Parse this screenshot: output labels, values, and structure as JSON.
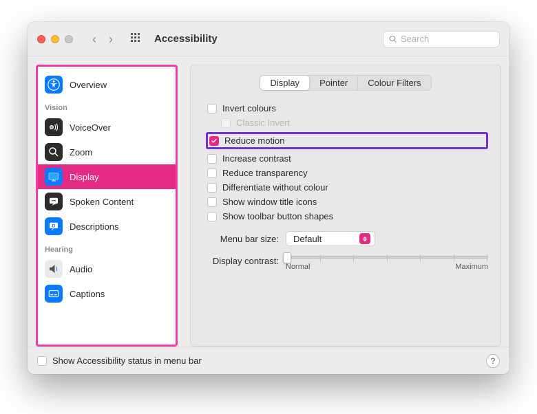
{
  "header": {
    "title": "Accessibility",
    "search_placeholder": "Search"
  },
  "sidebar": {
    "items": [
      {
        "label": "Overview",
        "section": null
      },
      {
        "label": "VoiceOver",
        "section": "Vision"
      },
      {
        "label": "Zoom",
        "section": "Vision"
      },
      {
        "label": "Display",
        "section": "Vision",
        "selected": true
      },
      {
        "label": "Spoken Content",
        "section": "Vision"
      },
      {
        "label": "Descriptions",
        "section": "Vision"
      },
      {
        "label": "Audio",
        "section": "Hearing"
      },
      {
        "label": "Captions",
        "section": "Hearing"
      }
    ],
    "sections": {
      "vision": "Vision",
      "hearing": "Hearing"
    }
  },
  "tabs": {
    "display": "Display",
    "pointer": "Pointer",
    "colour_filters": "Colour Filters"
  },
  "options": {
    "invert_colours": {
      "label": "Invert colours",
      "checked": false
    },
    "classic_invert": {
      "label": "Classic Invert",
      "checked": false,
      "disabled": true
    },
    "reduce_motion": {
      "label": "Reduce motion",
      "checked": true
    },
    "increase_contrast": {
      "label": "Increase contrast",
      "checked": false
    },
    "reduce_transparency": {
      "label": "Reduce transparency",
      "checked": false
    },
    "differentiate_without_colour": {
      "label": "Differentiate without colour",
      "checked": false
    },
    "show_window_title_icons": {
      "label": "Show window title icons",
      "checked": false
    },
    "show_toolbar_button_shapes": {
      "label": "Show toolbar button shapes",
      "checked": false
    }
  },
  "menu_bar_size": {
    "label": "Menu bar size:",
    "value": "Default"
  },
  "display_contrast": {
    "label": "Display contrast:",
    "min_label": "Normal",
    "max_label": "Maximum"
  },
  "footer": {
    "checkbox_label": "Show Accessibility status in menu bar",
    "help_char": "?"
  },
  "colors": {
    "accent": "#e52a86",
    "highlight_border": "#7233d6",
    "sidebar_border": "#ee3ea6"
  }
}
